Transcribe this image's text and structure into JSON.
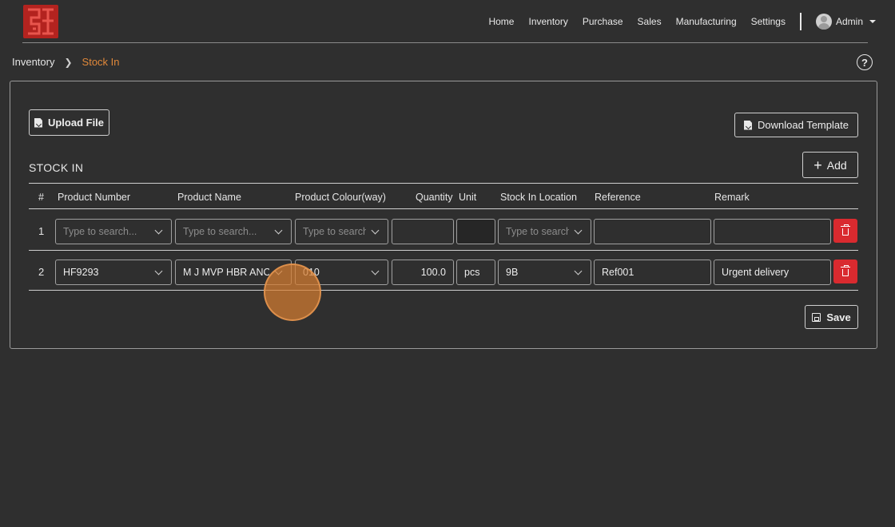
{
  "nav": {
    "items": [
      "Home",
      "Inventory",
      "Purchase",
      "Sales",
      "Manufacturing",
      "Settings"
    ],
    "user": "Admin"
  },
  "breadcrumb": {
    "parent": "Inventory",
    "current": "Stock In"
  },
  "buttons": {
    "upload": "Upload File",
    "download": "Download Template",
    "add": "Add",
    "save": "Save"
  },
  "section_title": "STOCK IN",
  "columns": [
    "#",
    "Product Number",
    "Product Name",
    "Product Colour(way)",
    "Quantity",
    "Unit",
    "Stock In Location",
    "Reference",
    "Remark"
  ],
  "rows": [
    {
      "num": "1",
      "product_number_placeholder": "Type to search...",
      "product_name_placeholder": "Type to search...",
      "colour_placeholder": "Type to search",
      "location_placeholder": "Type to search",
      "quantity": "",
      "unit": "",
      "reference": "",
      "remark": ""
    },
    {
      "num": "2",
      "product_number": "HF9293",
      "product_name": "M J MVP HBR ANORAK",
      "colour": "010",
      "quantity": "100.0",
      "unit": "pcs",
      "location": "9B",
      "reference": "Ref001",
      "remark": "Urgent delivery"
    }
  ],
  "colors": {
    "background": "#2f2f2f",
    "accent": "#e0883a",
    "danger": "#d92a2f",
    "logo": "#b3231f"
  }
}
